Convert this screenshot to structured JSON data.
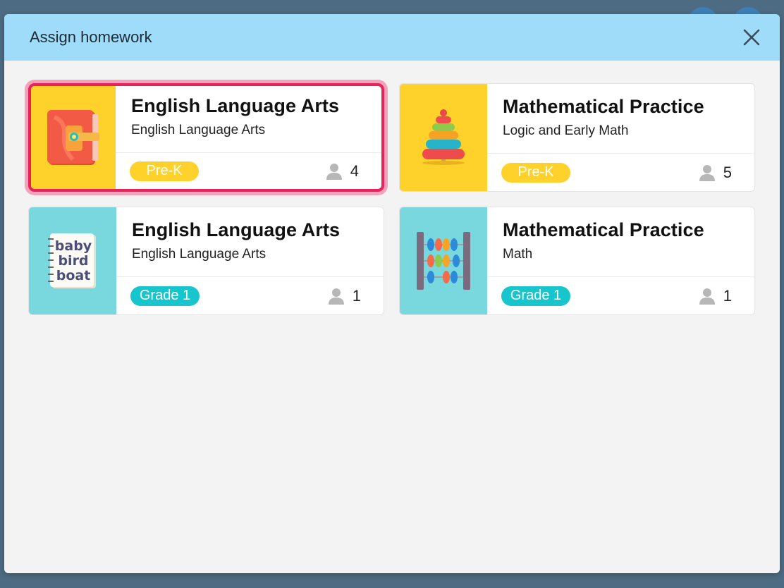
{
  "modal": {
    "title": "Assign homework"
  },
  "colors": {
    "header": "#9edcfa",
    "selected_border": "#e8225a",
    "yellow_thumb": "#ffd12b",
    "teal_thumb": "#79d8dd",
    "prek_pill": "#ffd12b",
    "grade_pill": "#16c6cc"
  },
  "cards": [
    {
      "title": "English Language Arts",
      "subtitle": "English Language Arts",
      "level": "Pre-K",
      "students": "4",
      "icon": "book-icon",
      "selected": true
    },
    {
      "title": "Mathematical Practice",
      "subtitle": "Logic and Early Math",
      "level": "Pre-K",
      "students": "5",
      "icon": "stacking-rings-icon",
      "selected": false
    },
    {
      "title": "English Language Arts",
      "subtitle": "English Language Arts",
      "level": "Grade 1",
      "students": "1",
      "icon": "notebook-icon",
      "selected": false,
      "thumb_words": [
        "baby",
        "bird",
        "boat"
      ]
    },
    {
      "title": "Mathematical Practice",
      "subtitle": "Math",
      "level": "Grade 1",
      "students": "1",
      "icon": "abacus-icon",
      "selected": false
    }
  ]
}
